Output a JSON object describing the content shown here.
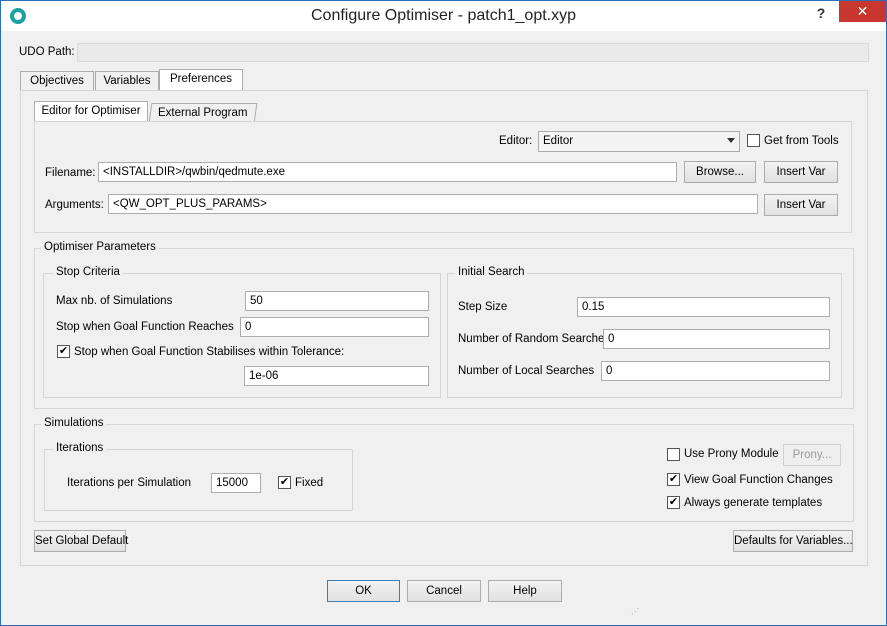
{
  "window": {
    "title": "Configure Optimiser - patch1_opt.xyp",
    "help_label": "?",
    "close_label": "✕"
  },
  "udo": {
    "label": "UDO Path:",
    "value": ""
  },
  "tabs": [
    {
      "label": "Objectives"
    },
    {
      "label": "Variables"
    },
    {
      "label": "Preferences"
    }
  ],
  "subtabs": [
    {
      "label": "Editor for Optimiser"
    },
    {
      "label": "External Program"
    }
  ],
  "editor": {
    "editor_label": "Editor:",
    "editor_value": "Editor",
    "get_from_tools": "Get from Tools",
    "filename_label": "Filename:",
    "filename_value": "<INSTALLDIR>/qwbin/qedmute.exe",
    "browse": "Browse...",
    "insert_var": "Insert Var",
    "arguments_label": "Arguments:",
    "arguments_value": "<QW_OPT_PLUS_PARAMS>"
  },
  "optimiser": {
    "title": "Optimiser Parameters",
    "stop": {
      "title": "Stop Criteria",
      "max_label": "Max nb. of Simulations",
      "max_value": "50",
      "goal_label": "Stop when Goal Function Reaches",
      "goal_value": "0",
      "stab_label": "Stop when Goal Function Stabilises within Tolerance:",
      "stab_checked": "✔",
      "tol_value": "1e-06"
    },
    "search": {
      "title": "Initial Search",
      "step_label": "Step Size",
      "step_value": "0.15",
      "random_label": "Number of Random Searches",
      "random_value": "0",
      "local_label": "Number of Local Searches",
      "local_value": "0"
    }
  },
  "simulations": {
    "title": "Simulations",
    "iterations_title": "Iterations",
    "iter_label": "Iterations per Simulation",
    "iter_value": "15000",
    "fixed_label": "Fixed",
    "fixed_checked": "✔",
    "prony_label": "Use Prony Module",
    "prony_button": "Prony...",
    "view_goal_label": "View Goal Function Changes",
    "view_goal_checked": "✔",
    "templates_label": "Always generate templates",
    "templates_checked": "✔"
  },
  "buttons": {
    "set_global": "Set Global Default",
    "defaults_vars": "Defaults for Variables...",
    "ok": "OK",
    "cancel": "Cancel",
    "help": "Help"
  }
}
